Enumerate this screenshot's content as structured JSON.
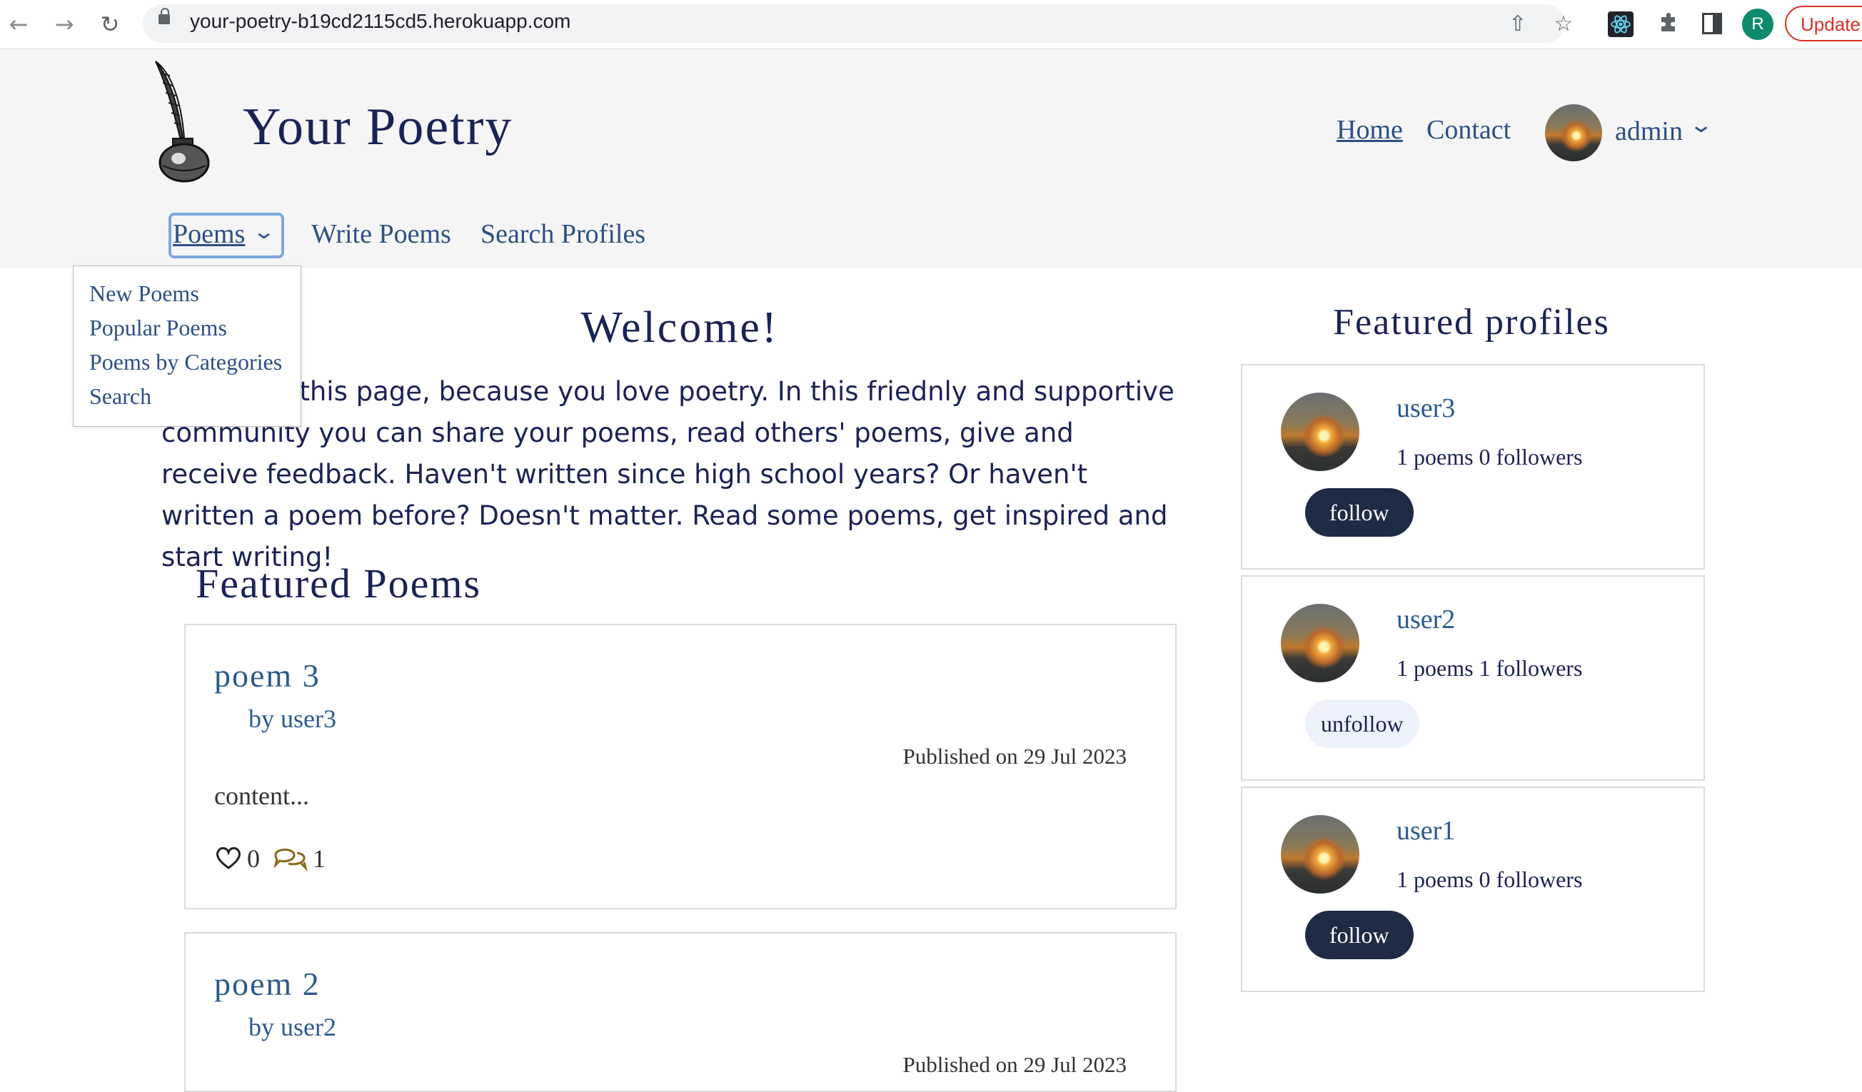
{
  "browser": {
    "url": "your-poetry-b19cd2115cd5.herokuapp.com",
    "profile_initial": "R",
    "update_label": "Update",
    "icons": [
      "back-icon",
      "forward-icon",
      "reload-icon",
      "lock-icon",
      "share-icon",
      "star-icon",
      "react-devtools-icon",
      "extensions-icon",
      "sidepanel-icon"
    ]
  },
  "header": {
    "brand": "Your Poetry",
    "nav": {
      "home": "Home",
      "contact": "Contact",
      "user": "admin"
    },
    "subnav": {
      "poems": "Poems",
      "write": "Write Poems",
      "search_profiles": "Search Profiles"
    }
  },
  "dropdown": {
    "items": [
      "New Poems",
      "Popular Poems",
      "Poems by Categories",
      "Search"
    ]
  },
  "welcome": {
    "title": "Welcome!",
    "text": "You found this page, because you love poetry. In this friednly and supportive community you can share your poems, read others' poems, give and receive feedback. Haven't written since high school years? Or haven't written a poem before? Doesn't matter. Read some poems, get inspired and start writing!"
  },
  "featured_poems": {
    "title": "Featured Poems",
    "poems": [
      {
        "title": "poem 3",
        "author": "by user3",
        "published": "Published on 29 Jul 2023",
        "content": "content...",
        "likes": "0",
        "comments": "1"
      },
      {
        "title": "poem 2",
        "author": "by user2",
        "published": "Published on 29 Jul 2023"
      }
    ]
  },
  "featured_profiles": {
    "title": "Featured profiles",
    "profiles": [
      {
        "name": "user3",
        "stats": "1 poems  0 followers",
        "button": "follow"
      },
      {
        "name": "user2",
        "stats": "1 poems  1 followers",
        "button": "unfollow"
      },
      {
        "name": "user1",
        "stats": "1 poems  0 followers",
        "button": "follow"
      }
    ]
  },
  "colors": {
    "navy": "#1a2355",
    "link": "#2c4f85",
    "button_dark": "#1f2a44",
    "button_light": "#eef3fb",
    "focus_ring": "#7fa7e0"
  }
}
